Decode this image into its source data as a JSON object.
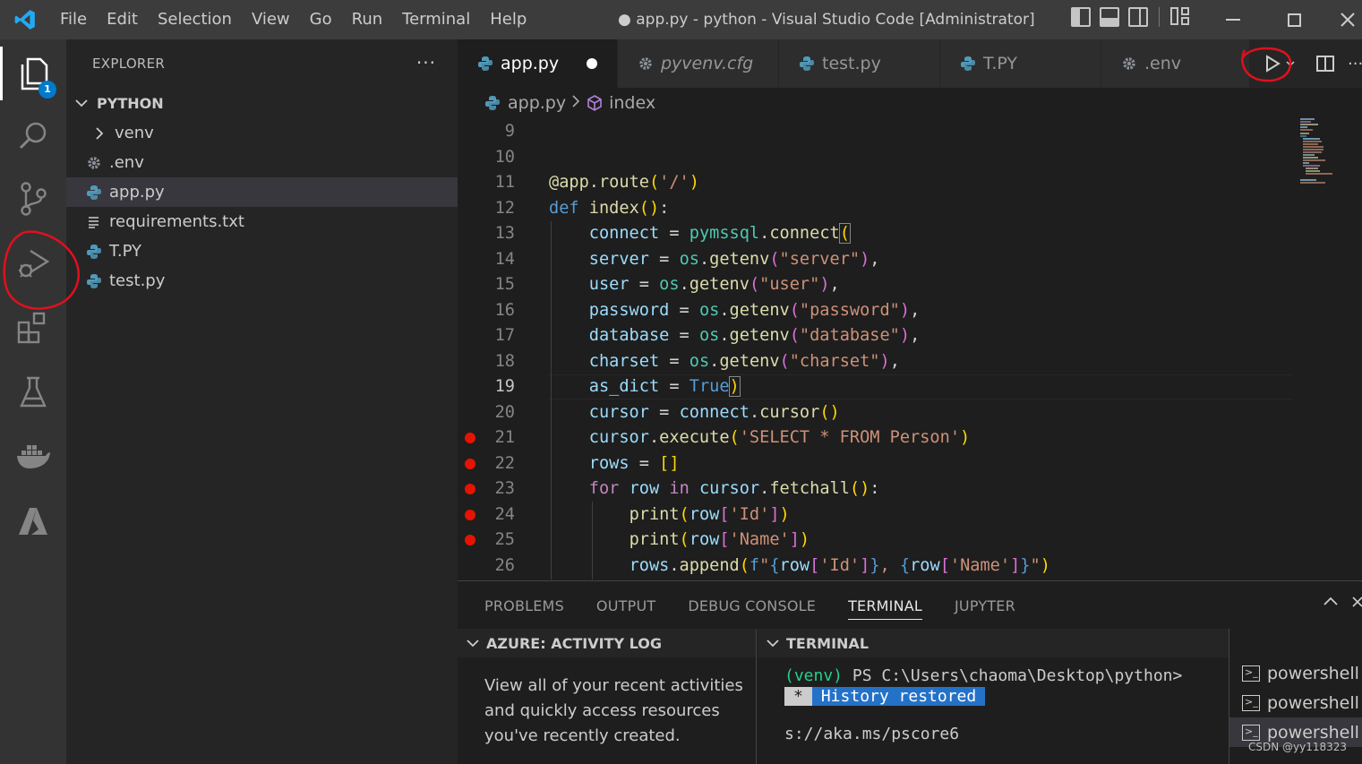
{
  "titlebar": {
    "menu": [
      "File",
      "Edit",
      "Selection",
      "View",
      "Go",
      "Run",
      "Terminal",
      "Help"
    ],
    "window_title": "● app.py - python - Visual Studio Code [Administrator]"
  },
  "activity": {
    "explorer_badge": "1"
  },
  "sidebar": {
    "header": "EXPLORER",
    "more": "···",
    "section": "PYTHON",
    "items": [
      {
        "label": "venv",
        "icon": "chevron-right-icon"
      },
      {
        "label": ".env",
        "icon": "gear-icon"
      },
      {
        "label": "app.py",
        "icon": "python-icon"
      },
      {
        "label": "requirements.txt",
        "icon": "text-lines-icon"
      },
      {
        "label": "T.PY",
        "icon": "python-icon"
      },
      {
        "label": "test.py",
        "icon": "python-icon"
      }
    ]
  },
  "tabs": [
    {
      "label": "app.py",
      "icon": "python-icon"
    },
    {
      "label": "pyvenv.cfg",
      "icon": "gear-icon"
    },
    {
      "label": "test.py",
      "icon": "python-icon"
    },
    {
      "label": "T.PY",
      "icon": "python-icon"
    },
    {
      "label": ".env",
      "icon": "gear-icon"
    }
  ],
  "breadcrumb": {
    "file": "app.py",
    "symbol": "index"
  },
  "code": {
    "line_numbers": [
      "9",
      "10",
      "11",
      "12",
      "13",
      "14",
      "15",
      "16",
      "17",
      "18",
      "19",
      "20",
      "21",
      "22",
      "23",
      "24",
      "25",
      "26"
    ],
    "current_line": "19",
    "breakpoints": [
      "21",
      "22",
      "23",
      "24",
      "25"
    ]
  },
  "panel": {
    "tabs": [
      "PROBLEMS",
      "OUTPUT",
      "DEBUG CONSOLE",
      "TERMINAL",
      "JUPYTER"
    ],
    "azure_header": "AZURE: ACTIVITY LOG",
    "azure_text": "View all of your recent activities and quickly access resources you've recently created.",
    "terminal_header": "TERMINAL",
    "terminal_lines": {
      "venv": "(venv)",
      "prompt": " PS C:\\Users\\chaoma\\Desktop\\python>",
      "star": "*",
      "history": "History restored",
      "url": "s://aka.ms/pscore6"
    },
    "shells": [
      "powershell",
      "powershell",
      "powershell"
    ]
  },
  "watermark": "CSDN @yy118323",
  "colors": {
    "accent": "#007acc",
    "breakpoint": "#e51400",
    "annotation": "#e0101e"
  }
}
